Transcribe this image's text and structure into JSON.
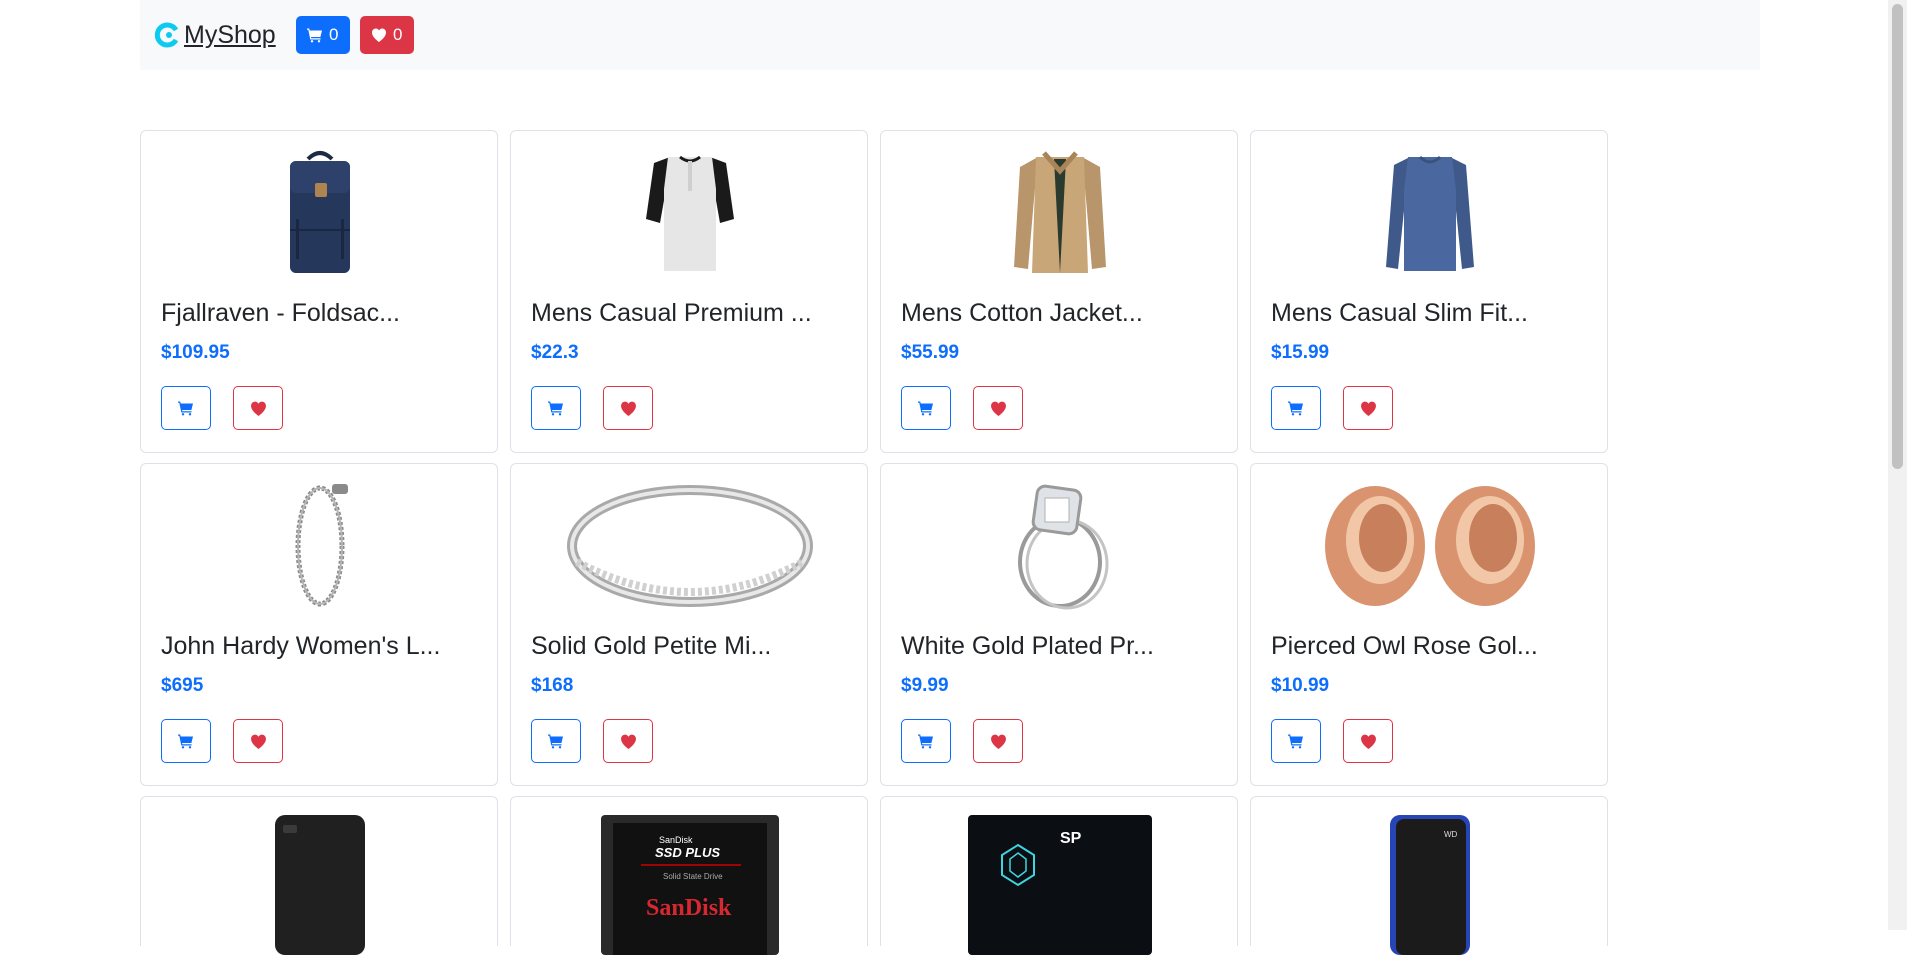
{
  "navbar": {
    "brand": "MyShop",
    "cart_count": "0",
    "favorites_count": "0"
  },
  "products": [
    {
      "title": "Fjallraven - Foldsac...",
      "price": "$109.95",
      "image": "backpack"
    },
    {
      "title": "Mens Casual Premium ...",
      "price": "$22.3",
      "image": "henley-shirt"
    },
    {
      "title": "Mens Cotton Jacket...",
      "price": "$55.99",
      "image": "cotton-jacket"
    },
    {
      "title": "Mens Casual Slim Fit...",
      "price": "$15.99",
      "image": "slim-fit-shirt"
    },
    {
      "title": "John Hardy Women's L...",
      "price": "$695",
      "image": "dragon-bracelet"
    },
    {
      "title": "Solid Gold Petite Mi...",
      "price": "$168",
      "image": "micropave-ring"
    },
    {
      "title": "White Gold Plated Pr...",
      "price": "$9.99",
      "image": "princess-ring"
    },
    {
      "title": "Pierced Owl Rose Gol...",
      "price": "$10.99",
      "image": "rose-gold-tunnels"
    }
  ],
  "partial_products": [
    {
      "image": "external-hard-drive"
    },
    {
      "image": "sandisk-ssd",
      "logo_small": "SanDisk",
      "logo_line": "SSD PLUS",
      "logo_sub": "Solid State Drive",
      "logo_brand": "SanDisk"
    },
    {
      "image": "silicon-power-ssd",
      "logo_brand": "SP"
    },
    {
      "image": "gaming-drive"
    }
  ],
  "colors": {
    "primary": "#0d6efd",
    "danger": "#dc3545",
    "navbar_bg": "#f8f9fa"
  },
  "icons": {
    "cart": "cart-icon",
    "favorite": "heart-icon",
    "logo": "myshop-logo-icon"
  }
}
